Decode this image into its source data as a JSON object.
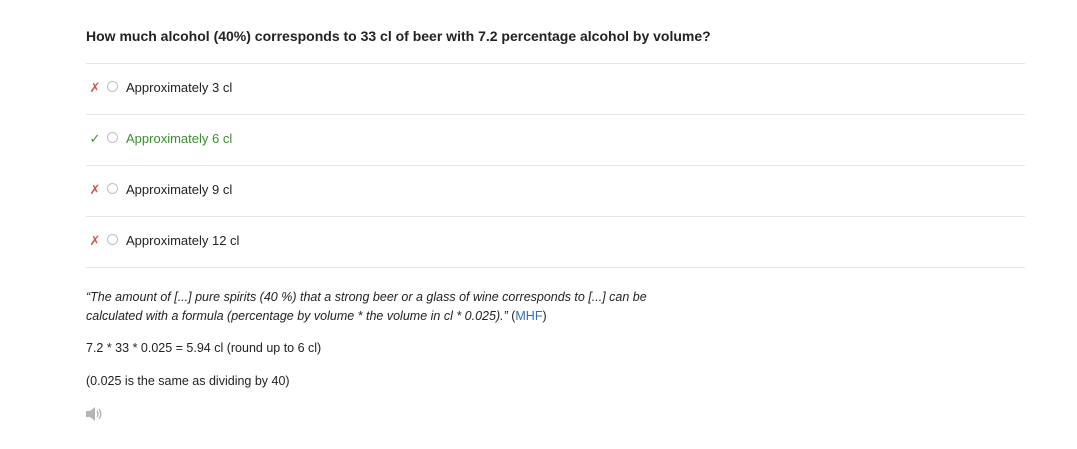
{
  "question": {
    "text": "How much alcohol (40%) corresponds to 33 cl of beer with 7.2 percentage alcohol by volume?"
  },
  "options": [
    {
      "label": "Approximately 3 cl",
      "mark": "✗",
      "status": "wrong"
    },
    {
      "label": "Approximately 6 cl",
      "mark": "✓",
      "status": "correct"
    },
    {
      "label": "Approximately 9 cl",
      "mark": "✗",
      "status": "wrong"
    },
    {
      "label": "Approximately 12 cl",
      "mark": "✗",
      "status": "wrong"
    }
  ],
  "explanation": {
    "quote_line1": "“The amount of [...] pure spirits (40 %) that a strong beer or a glass of wine corresponds to [...] can be",
    "quote_line2": "calculated with a formula (percentage by volume * the volume in cl * 0.025).”",
    "open_paren": " (",
    "source_link": "MHF",
    "close_paren": ")",
    "calculation": "7.2 * 33 * 0.025 = 5.94 cl (round up to 6 cl)",
    "note": "(0.025 is the same as dividing by 40)"
  },
  "audio": {
    "icon": "speaker-icon"
  },
  "colors": {
    "wrong": "#d9534f",
    "correct": "#3c8d2f",
    "link": "#2f6db5",
    "divider": "#e6e6e6"
  }
}
